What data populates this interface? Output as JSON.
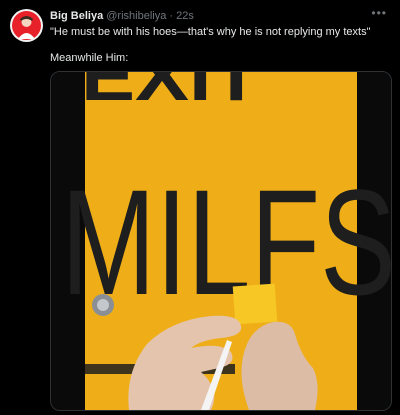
{
  "tweet": {
    "author_name": "Big Beliya",
    "author_handle": "@rishibeliya",
    "separator": "·",
    "timestamp": "22s",
    "more_icon": "more-horizontal-icon",
    "text_line_1": "\"He must be with his hoes—that's why he is not replying my texts\"",
    "text_line_2": "Meanwhile Him:"
  },
  "media": {
    "sign_text_top": "EXIT",
    "sign_text_main": "MILFS",
    "colors": {
      "sign_yellow": "#f2b21a",
      "sign_letters": "#1e1e1e",
      "tape": "#f5c520"
    }
  }
}
